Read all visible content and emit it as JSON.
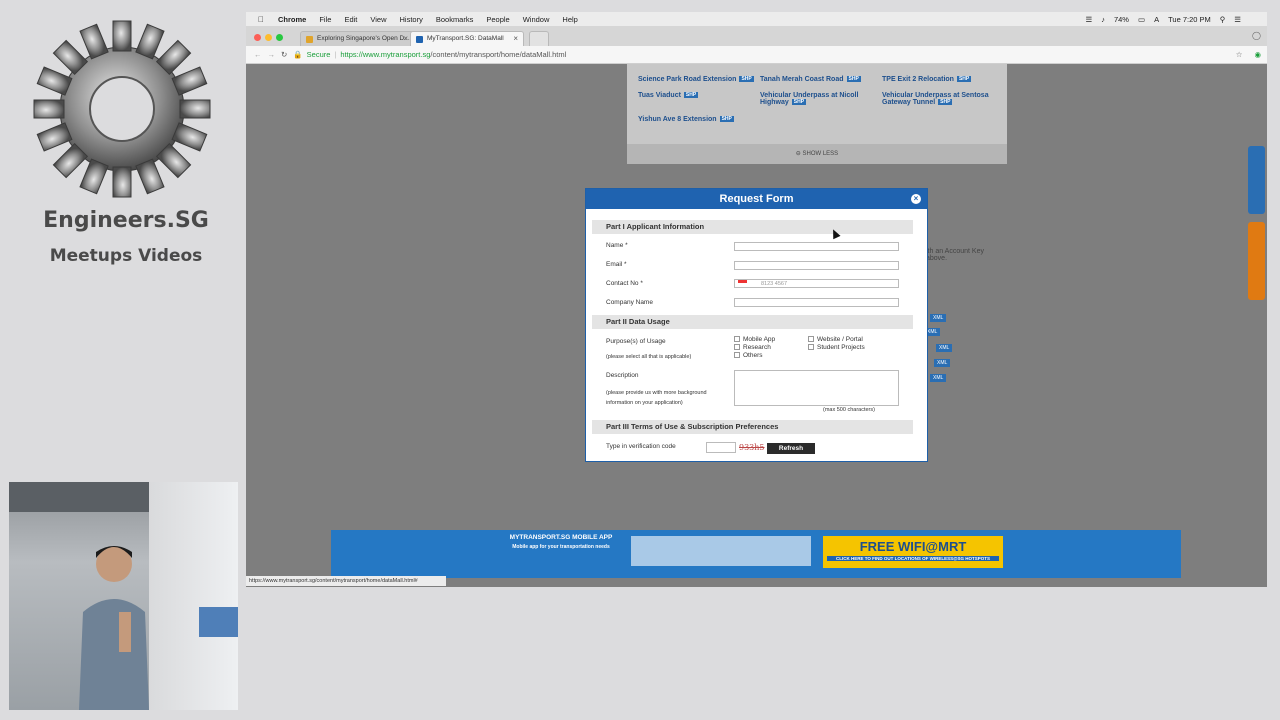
{
  "brand": {
    "title": "Engineers.SG",
    "subtitle": "Meetups Videos"
  },
  "menubar": {
    "app": "Chrome",
    "items": [
      "File",
      "Edit",
      "View",
      "History",
      "Bookmarks",
      "People",
      "Window",
      "Help"
    ],
    "battery": "74%",
    "clock": "Tue 7:20 PM"
  },
  "tabs": [
    {
      "title": "Exploring Singapore's Open D..."
    },
    {
      "title": "MyTransport.SG: DataMall"
    }
  ],
  "address": {
    "secure_label": "Secure",
    "domain": "https://www.mytransport.sg",
    "path": "/content/mytransport/home/dataMall.html"
  },
  "site": {
    "links": [
      "Science Park Road Extension",
      "Tanah Merah Coast Road",
      "TPE Exit 2 Relocation",
      "Tuas Viaduct",
      "Vehicular Underpass at Nicoll Highway",
      "Vehicular Underpass at Sentosa Gateway Tunnel",
      "Yishun Ave 8 Extension"
    ],
    "badge": "SHP",
    "show_less": "SHOW LESS",
    "side_text": "ith an Account Key above.",
    "xml_badge": "XML",
    "status_url": "https://www.mytransport.sg/content/mytransport/home/dataMall.html#",
    "banner_app_title": "MYTRANSPORT.SG MOBILE APP",
    "banner_app_sub": "Mobile app for your transportation needs",
    "banner_wifi": "FREE WIFI@MRT",
    "banner_wifi_sub": "CLICK HERE TO FIND OUT LOCATIONS OF WIRELESS@SG HOTSPOTS"
  },
  "modal": {
    "title": "Request Form",
    "part1": "Part I Applicant Information",
    "name_label": "Name *",
    "email_label": "Email *",
    "contact_label": "Contact No *",
    "contact_placeholder": "8123 4567",
    "company_label": "Company Name",
    "part2": "Part II Data Usage",
    "purpose_label": "Purpose(s) of Usage",
    "purpose_hint": "(please select all that is applicable)",
    "options": [
      "Mobile App",
      "Website / Portal",
      "Research",
      "Student Projects",
      "Others"
    ],
    "description_label": "Description",
    "description_hint": "(please provide us with more background information on your application)",
    "max_chars": "(max 500 characters)",
    "part3": "Part III Terms of Use & Subscription Preferences",
    "verification_label": "Type in verification code",
    "captcha": "933h5",
    "refresh": "Refresh"
  }
}
